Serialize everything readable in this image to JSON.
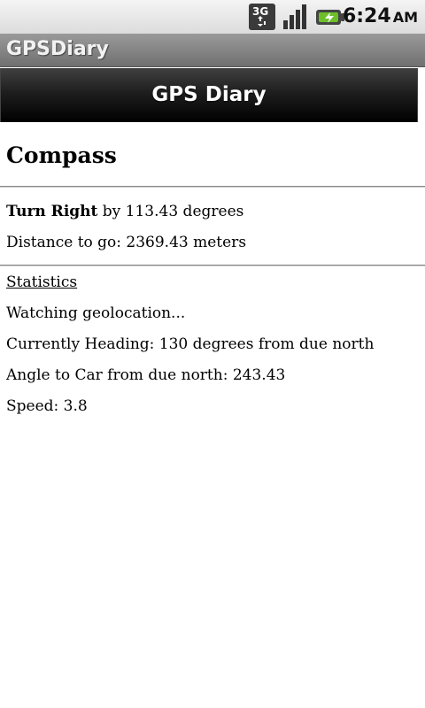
{
  "status_bar": {
    "network_icon": "3g-data-icon",
    "signal_icon": "signal-strength-icon",
    "battery_icon": "battery-charging-icon",
    "time": "6:24",
    "ampm": "AM"
  },
  "app": {
    "title": "GPSDiary"
  },
  "web_header": {
    "title": "GPS Diary"
  },
  "main": {
    "title": "Compass",
    "turn": {
      "direction": "Turn Right",
      "suffix": " by 113.43 degrees"
    },
    "distance": "Distance to go: 2369.43 meters",
    "statistics_link": "Statistics",
    "watching": "Watching geolocation...",
    "heading": "Currently Heading: 130 degrees from due north",
    "angle": "Angle to Car from due north: 243.43",
    "speed": "Speed: 3.8"
  }
}
